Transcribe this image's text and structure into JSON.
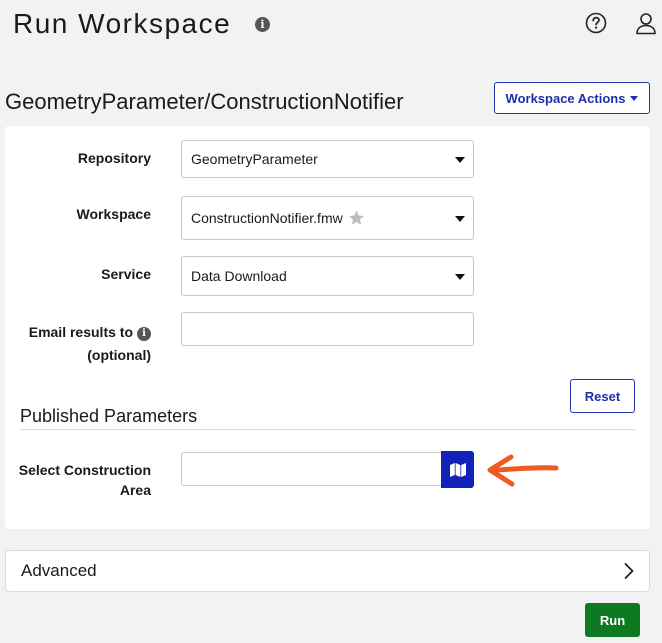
{
  "page": {
    "title": "Run Workspace",
    "info_glyph": "i"
  },
  "header_icons": [
    "help-icon",
    "user-icon"
  ],
  "workspace_heading": "GeometryParameter/ConstructionNotifier",
  "workspace_actions": {
    "label": "Workspace Actions"
  },
  "form": {
    "repository": {
      "label": "Repository",
      "value": "GeometryParameter"
    },
    "workspace": {
      "label": "Workspace",
      "value": "ConstructionNotifier.fmw",
      "favorite_icon": "star-icon"
    },
    "service": {
      "label": "Service",
      "value": "Data Download"
    },
    "email": {
      "label_line1": "Email results to",
      "label_line2": "(optional)",
      "value": "",
      "info_glyph": "i"
    },
    "reset_label": "Reset"
  },
  "published_parameters": {
    "title": "Published Parameters",
    "construction_area": {
      "label_line1": "Select Construction",
      "label_line2": "Area",
      "value": "",
      "button_icon": "map-icon"
    }
  },
  "advanced": {
    "label": "Advanced",
    "icon": "chevron-right-icon"
  },
  "run_label": "Run",
  "colors": {
    "accent_blue": "#1c2fae",
    "map_button": "#1122b8",
    "run_green": "#0d7a22",
    "annotation_arrow": "#f05a22"
  }
}
